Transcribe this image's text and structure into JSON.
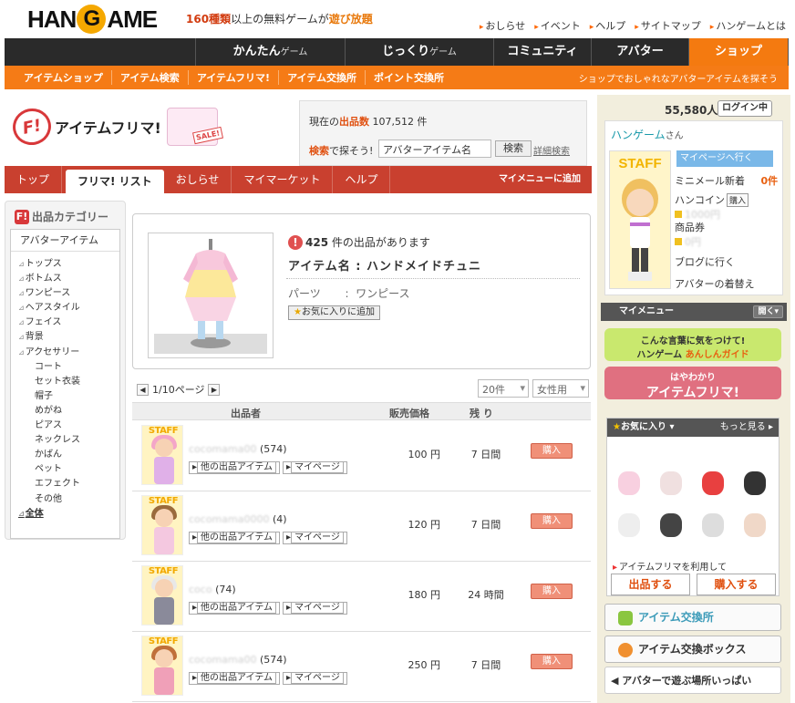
{
  "header": {
    "logo_pre": "HAN",
    "logo_g": "G",
    "logo_post": "AME",
    "tag_num": "160種類",
    "tag_mid": "以上の無料ゲームが",
    "tag_end": "遊び放題",
    "links": [
      "おしらせ",
      "イベント",
      "ヘルプ",
      "サイトマップ",
      "ハンゲームとは"
    ]
  },
  "gnav": [
    {
      "main": "かんたん",
      "sub": "ゲーム"
    },
    {
      "main": "じっくり",
      "sub": "ゲーム"
    },
    {
      "main": "コミュニティ",
      "sub": ""
    },
    {
      "main": "アバター",
      "sub": ""
    },
    {
      "main": "ショップ",
      "sub": ""
    }
  ],
  "snav": {
    "items": [
      "アイテムショップ",
      "アイテム検索",
      "アイテムフリマ!",
      "アイテム交換所",
      "ポイント交換所"
    ],
    "right": "ショップでおしゃれなアバターアイテムを探そう"
  },
  "brand": {
    "badge": "F!",
    "title": "アイテムフリマ!",
    "sale": "SALE!"
  },
  "stats": {
    "l1_pre": "現在の",
    "l1_key": "出品数",
    "l1_val": "107,512 件",
    "l2_key": "検索",
    "l2_post": "で探そう!",
    "search_value": "アバターアイテム名",
    "search_btn": "検索",
    "advanced": "詳細検索"
  },
  "tabs": {
    "items": [
      "トップ",
      "フリマ! リスト",
      "おしらせ",
      "マイマーケット",
      "ヘルプ"
    ],
    "right": "マイメニューに追加"
  },
  "category": {
    "title": "出品カテゴリー",
    "root": "アバターアイテム",
    "items": [
      "トップス",
      "ボトムス",
      "ワンピース",
      "ヘアスタイル",
      "フェイス",
      "背景",
      "アクセサリー"
    ],
    "subs": [
      "コート",
      "セット衣装",
      "帽子",
      "めがね",
      "ピアス",
      "ネックレス",
      "かばん",
      "ペット",
      "エフェクト",
      "その他"
    ],
    "all": "全体"
  },
  "product": {
    "count": "425",
    "count_post": "件の出品があります",
    "name": "アイテム名 : ハンドメイドチュニ",
    "parts_label": "パーツ",
    "parts_sep": ":",
    "parts_value": "ワンピース",
    "fav_btn": "お気に入りに追加"
  },
  "list": {
    "page": "1/10ページ",
    "per_page": "20件",
    "gender": "女性用",
    "headers": {
      "seller": "出品者",
      "price": "販売価格",
      "remain": "残 り"
    },
    "rows": [
      {
        "blur": "cocomama00",
        "count": "(574)",
        "price": "100 円",
        "remain": "7 日間",
        "hair": "#f4a6c8",
        "body": "#e0b0e8"
      },
      {
        "blur": "cocomama0000",
        "count": "(4)",
        "price": "120 円",
        "remain": "7 日間",
        "hair": "#9a6a3c",
        "body": "#f4c8e0"
      },
      {
        "blur": "coco",
        "count": "(74)",
        "price": "180 円",
        "remain": "24 時間",
        "hair": "#e8e8e8",
        "body": "#8a8a9a"
      },
      {
        "blur": "cocomama00",
        "count": "(574)",
        "price": "250 円",
        "remain": "7 日間",
        "hair": "#c0703a",
        "body": "#f0a0b8"
      }
    ],
    "btn_items": "他の出品アイテム",
    "btn_mypage": "マイページ",
    "buy": "購入"
  },
  "right": {
    "users": "55,580人",
    "login": "ログイン中",
    "name": "ハンゲーム",
    "san": "さん",
    "mypage": "マイページへ行く",
    "mail": "ミニメール新着",
    "mail_count": "0件",
    "coin": "ハンコイン",
    "coin_btn": "購入",
    "coin_val": "1000円",
    "ticket": "商品券",
    "ticket_val": "0円",
    "blog": "ブログに行く",
    "dress": "アバターの着替え",
    "mymenu": "マイメニュー",
    "open": "開く",
    "guide1": "こんな言葉に気をつけて!",
    "guide2": "ハンゲーム",
    "guide3": "あんしんガイド",
    "fm1": "はやわかり",
    "fm2": "アイテムフリマ!",
    "fav": "お気に入り",
    "more": "もっと見る",
    "use": "アイテムフリマを利用して",
    "sell": "出品する",
    "buy": "購入する",
    "exchange": "アイテム交換所",
    "exbox": "アイテム交換ボックス",
    "play": "アバターで遊ぶ場所いっぱい"
  },
  "colors": {
    "brand_orange": "#f57b16",
    "nav_dark": "#2a2a2a",
    "tab_red": "#c9402f",
    "accent": "#e05010"
  }
}
